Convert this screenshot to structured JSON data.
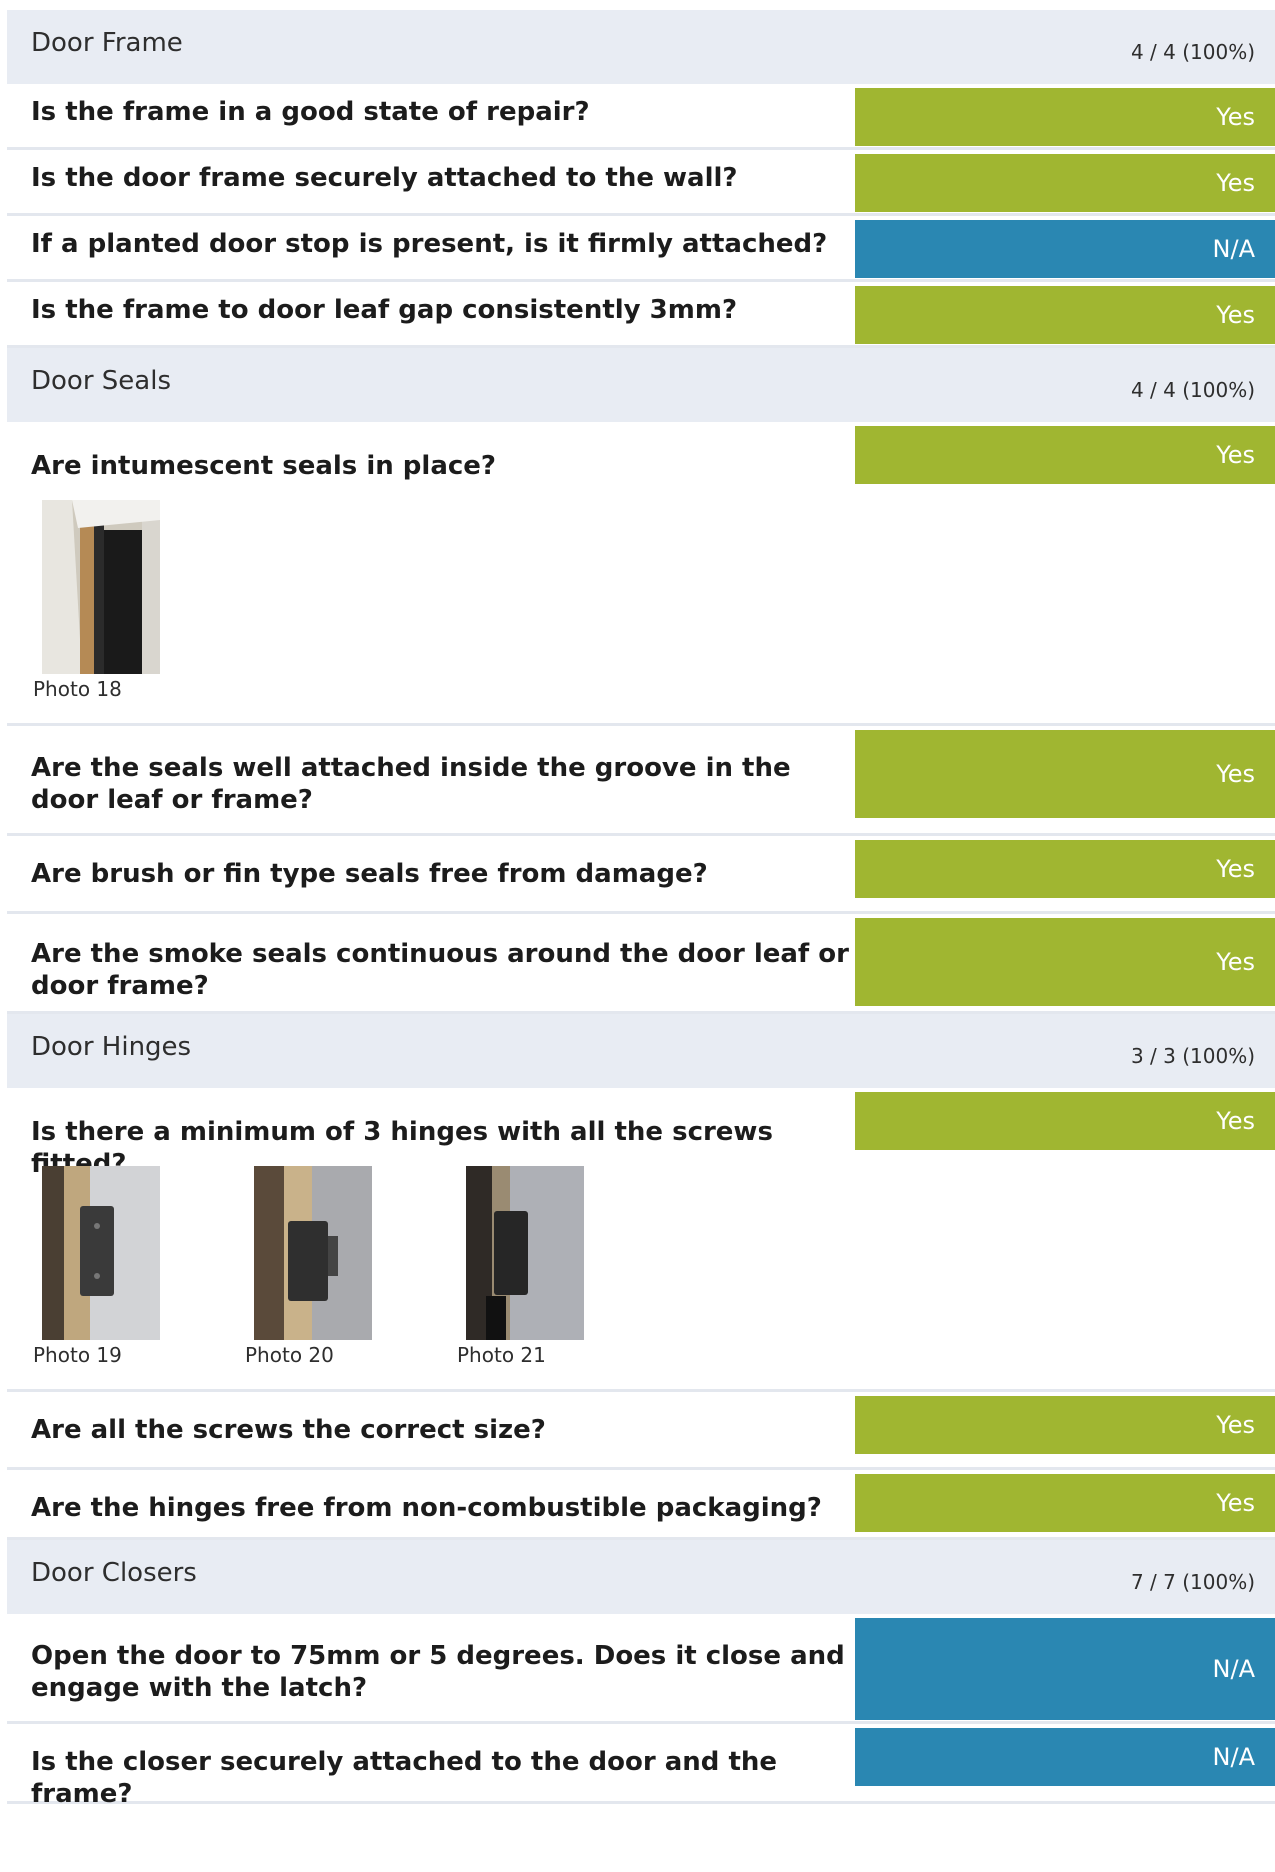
{
  "sections": [
    {
      "title": "Door Frame",
      "score": "4 / 4 (100%)",
      "questions": [
        {
          "text": "Is the frame in a good state of repair?",
          "answer": "Yes"
        },
        {
          "text": "Is the door frame securely attached to the wall?",
          "answer": "Yes"
        },
        {
          "text": "If a planted door stop is present, is it firmly attached?",
          "answer": "N/A"
        },
        {
          "text": "Is the frame to door leaf gap consistently 3mm?",
          "answer": "Yes"
        }
      ]
    },
    {
      "title": "Door Seals",
      "score": "4 / 4 (100%)",
      "questions": [
        {
          "text": "Are intumescent seals in place?",
          "answer": "Yes",
          "photos": [
            "Photo 18"
          ]
        },
        {
          "text": "Are the seals well attached inside the groove in the door leaf or frame?",
          "answer": "Yes"
        },
        {
          "text": "Are brush or fin type seals free from damage?",
          "answer": "Yes"
        },
        {
          "text": "Are the smoke seals continuous around the door leaf or door frame?",
          "answer": "Yes"
        }
      ]
    },
    {
      "title": "Door Hinges",
      "score": "3 / 3 (100%)",
      "questions": [
        {
          "text": "Is there a minimum of 3 hinges with all the screws fitted?",
          "answer": "Yes",
          "photos": [
            "Photo 19",
            "Photo 20",
            "Photo 21"
          ]
        },
        {
          "text": "Are all the screws the correct size?",
          "answer": "Yes"
        },
        {
          "text": "Are the hinges free from non-combustible packaging?",
          "answer": "Yes"
        }
      ]
    },
    {
      "title": "Door Closers",
      "score": "7 / 7 (100%)",
      "questions": [
        {
          "text": "Open the door to 75mm or 5 degrees. Does it close and engage with the latch?",
          "answer": "N/A"
        },
        {
          "text": "Is the closer securely attached to the door and the frame?",
          "answer": "N/A"
        }
      ]
    }
  ],
  "colors": {
    "yes": "#a0b631",
    "na": "#2a87b2",
    "section_bg": "#e8ecf3"
  }
}
